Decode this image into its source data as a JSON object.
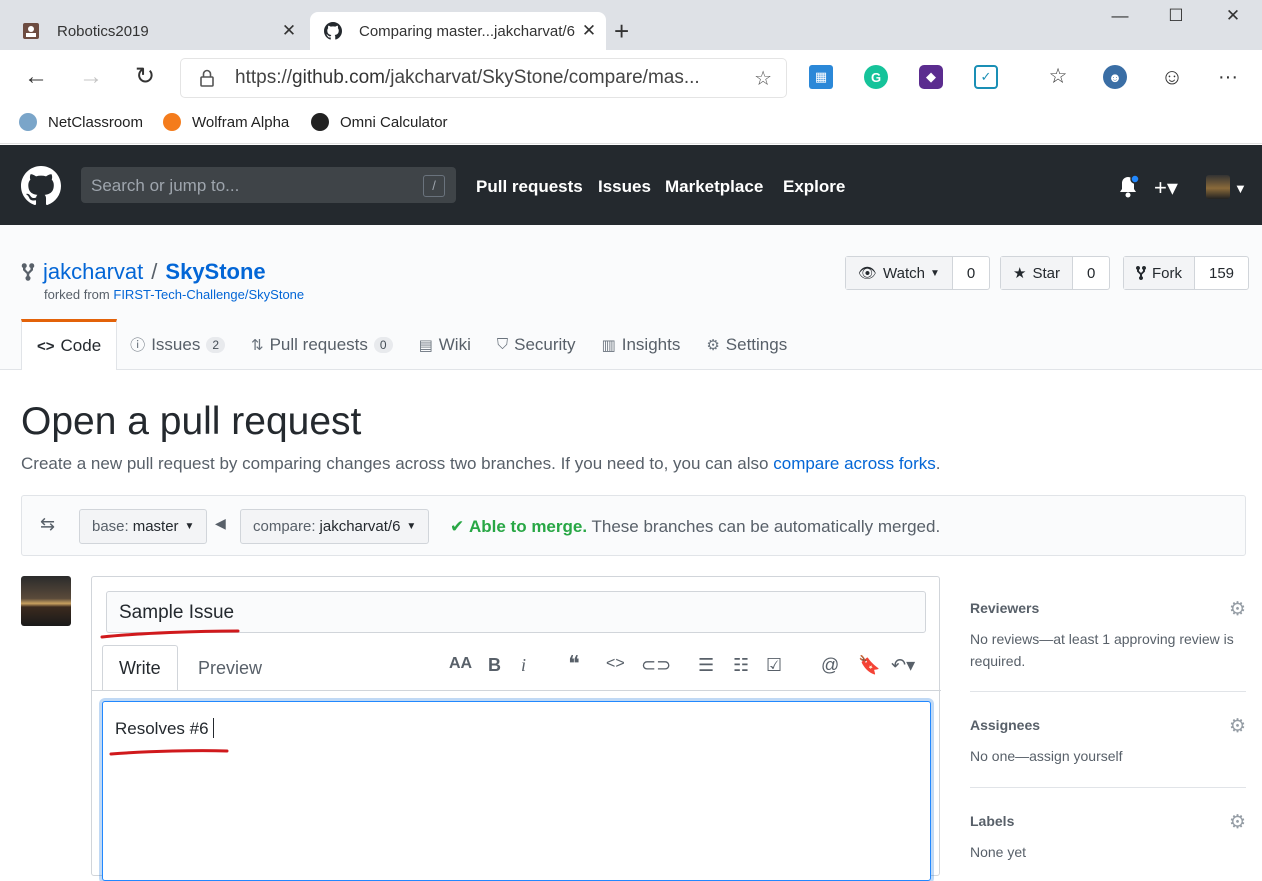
{
  "browser": {
    "tabs": [
      {
        "title": "Robotics2019",
        "active": false
      },
      {
        "title": "Comparing master...jakcharvat/6",
        "active": true
      }
    ],
    "url_prefix": "https://",
    "url_domain": "github.com",
    "url_path": "/jakcharvat/SkyStone/compare/mas...",
    "bookmarks": [
      "NetClassroom",
      "Wolfram Alpha",
      "Omni Calculator"
    ]
  },
  "github": {
    "search_placeholder": "Search or jump to...",
    "search_hint": "/",
    "nav": [
      "Pull requests",
      "Issues",
      "Marketplace",
      "Explore"
    ]
  },
  "repo": {
    "owner": "jakcharvat",
    "separator": "/",
    "name": "SkyStone",
    "forked_prefix": "forked from",
    "forked_from": "FIRST-Tech-Challenge/SkyStone",
    "watch_label": "Watch",
    "watch_count": "0",
    "star_label": "Star",
    "star_count": "0",
    "fork_label": "Fork",
    "fork_count": "159",
    "tabs": {
      "code": "Code",
      "issues": "Issues",
      "issues_count": "2",
      "pulls": "Pull requests",
      "pulls_count": "0",
      "wiki": "Wiki",
      "security": "Security",
      "insights": "Insights",
      "settings": "Settings"
    }
  },
  "page": {
    "title": "Open a pull request",
    "subtitle": "Create a new pull request by comparing changes across two branches. If you need to, you can also",
    "subtitle_link": "compare across forks",
    "subtitle_end": "."
  },
  "compare": {
    "base_label": "base:",
    "base_branch": "master",
    "compare_label": "compare:",
    "compare_branch": "jakcharvat/6",
    "merge_status": "Able to merge.",
    "merge_detail": "These branches can be automatically merged."
  },
  "form": {
    "title_value": "Sample Issue",
    "write_tab": "Write",
    "preview_tab": "Preview",
    "body_value": "Resolves #6"
  },
  "sidebar": {
    "reviewers_title": "Reviewers",
    "reviewers_text": "No reviews—at least 1 approving review is required.",
    "assignees_title": "Assignees",
    "assignees_text": "No one—assign yourself",
    "labels_title": "Labels",
    "labels_text": "None yet"
  },
  "colors": {
    "github_header": "#24292e",
    "link": "#0366d6",
    "merge_ok": "#28a745",
    "active_tab_border": "#e36209",
    "annotation_red": "#d0191c"
  }
}
